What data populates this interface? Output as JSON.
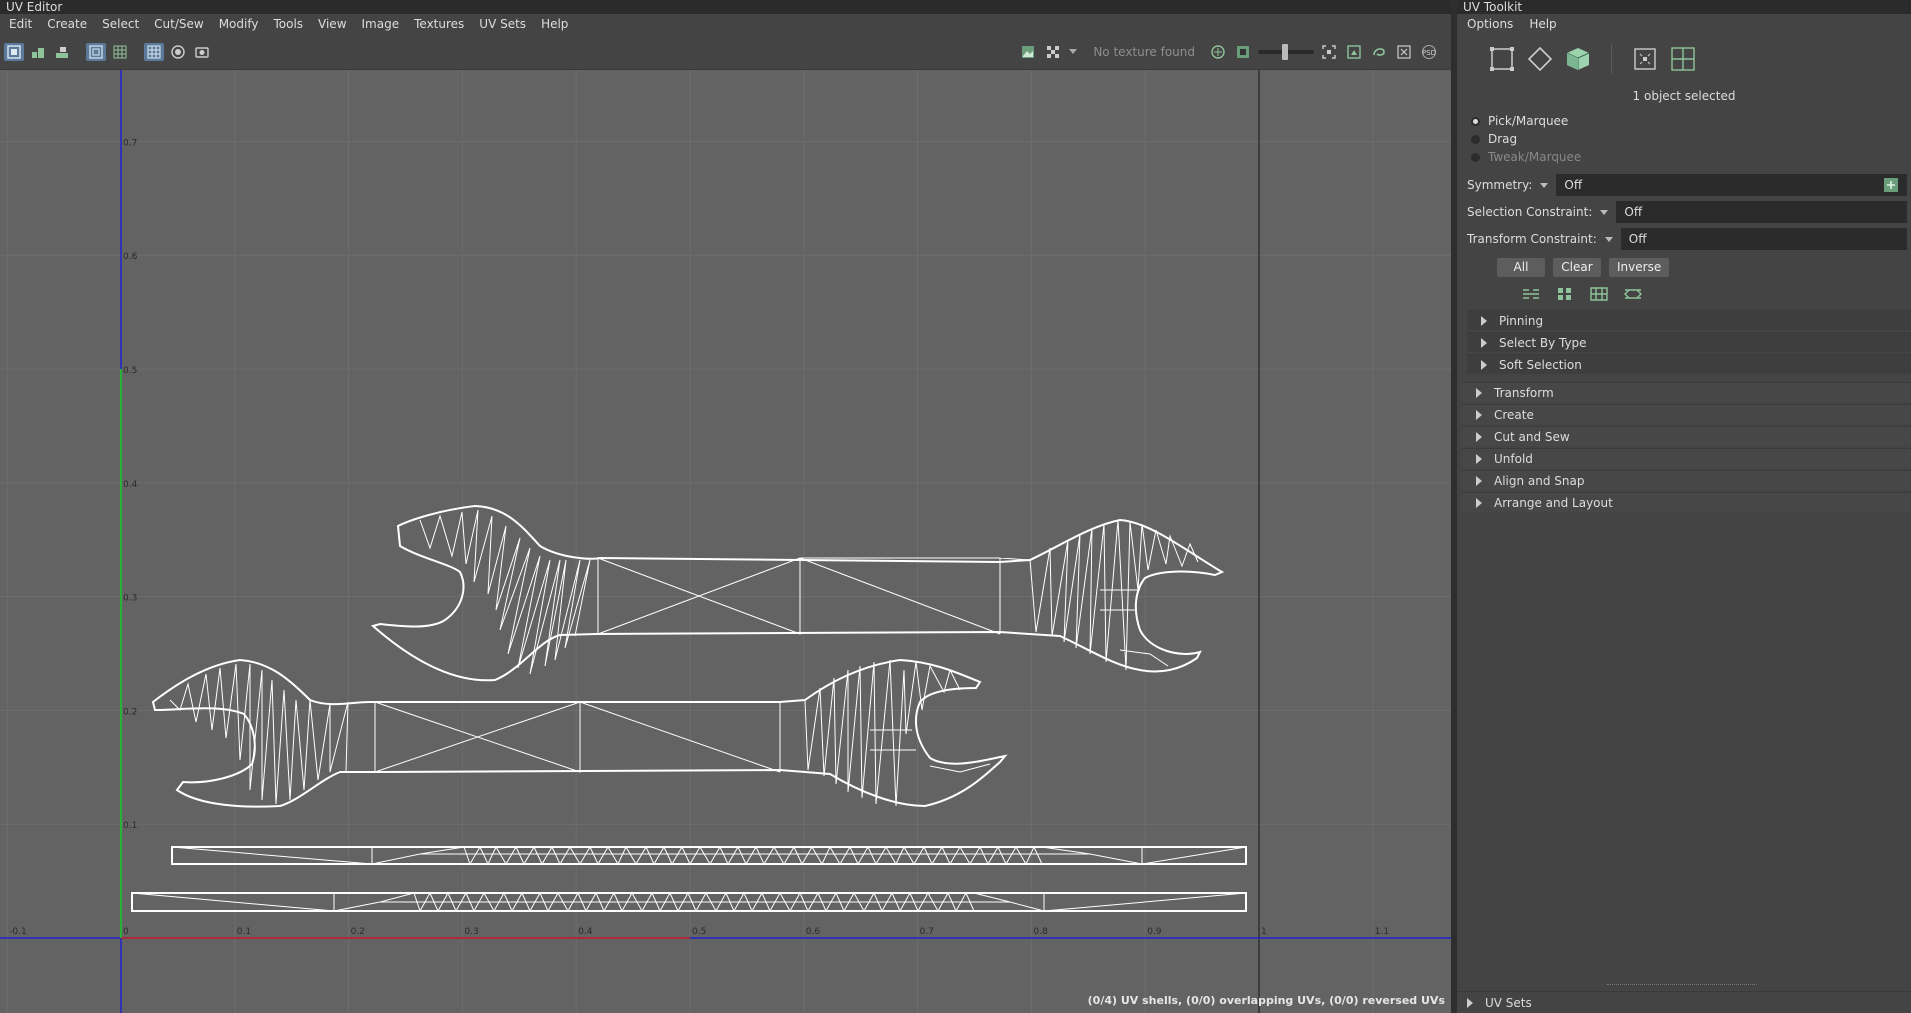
{
  "uv_editor": {
    "title": "UV Editor",
    "menu": [
      "Edit",
      "Create",
      "Select",
      "Cut/Sew",
      "Modify",
      "Tools",
      "View",
      "Image",
      "Textures",
      "UV Sets",
      "Help"
    ],
    "toolbar": {
      "texture_status": "No texture found",
      "left_icons": [
        "uv-shell-icon",
        "uv-layout-icon",
        "uv-stack-icon",
        "wireframe-icon",
        "texture-grid-icon",
        "grid-icon",
        "shaded-icon",
        "snapshot-icon"
      ],
      "right_icons": [
        "image-icon",
        "checker-icon",
        "dropdown-icon",
        "exposure-icon",
        "image-range-icon",
        "gamma-slider-icon",
        "isolate-icon",
        "frame-icon",
        "lasso-icon",
        "close-box-icon",
        "psd-icon"
      ]
    },
    "axis_ticks": {
      "u": [
        "-0.1",
        "0",
        "0.1",
        "0.2",
        "0.3",
        "0.4",
        "0.5",
        "0.6",
        "0.7",
        "0.8",
        "0.9",
        "1",
        "1.1"
      ],
      "v": [
        "0.1",
        "0.2",
        "0.3",
        "0.4",
        "0.5",
        "0.6",
        "0.7"
      ]
    },
    "status": "(0/4) UV shells, (0/0) overlapping UVs, (0/0) reversed UVs",
    "colors": {
      "u_axis": "#cc2222",
      "v_axis": "#22cc22",
      "blue_axis": "#2222cc",
      "mesh": "#ffffff"
    }
  },
  "uv_toolkit": {
    "title": "UV Toolkit",
    "menu": [
      "Options",
      "Help"
    ],
    "selection_count": "1 object selected",
    "tools": [
      {
        "label": "Pick/Marquee",
        "selected": true,
        "enabled": true
      },
      {
        "label": "Drag",
        "selected": false,
        "enabled": true
      },
      {
        "label": "Tweak/Marquee",
        "selected": false,
        "enabled": false
      }
    ],
    "symmetry": {
      "label": "Symmetry:",
      "value": "Off"
    },
    "selection_constraint": {
      "label": "Selection Constraint:",
      "value": "Off"
    },
    "transform_constraint": {
      "label": "Transform Constraint:",
      "value": "Off"
    },
    "buttons": {
      "all": "All",
      "clear": "Clear",
      "inverse": "Inverse"
    },
    "sub_sections": [
      "Pinning",
      "Select By Type",
      "Soft Selection"
    ],
    "sections": [
      "Transform",
      "Create",
      "Cut and Sew",
      "Unfold",
      "Align and Snap",
      "Arrange and Layout"
    ],
    "bottom_section": "UV Sets"
  }
}
